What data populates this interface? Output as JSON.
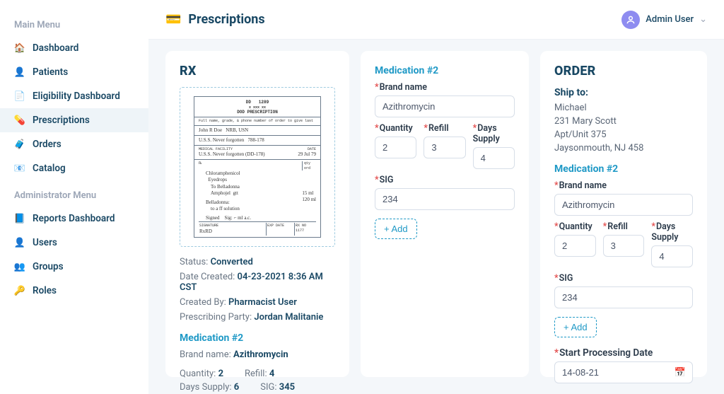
{
  "sidebar": {
    "mainHeader": "Main Menu",
    "adminHeader": "Administrator Menu",
    "main": [
      {
        "icon": "home-icon",
        "glyph": "🏠",
        "label": "Dashboard"
      },
      {
        "icon": "patients-icon",
        "glyph": "👤",
        "label": "Patients"
      },
      {
        "icon": "eligibility-icon",
        "glyph": "📄",
        "label": "Eligibility Dashboard"
      },
      {
        "icon": "prescriptions-icon",
        "glyph": "💊",
        "label": "Prescriptions",
        "active": true
      },
      {
        "icon": "orders-icon",
        "glyph": "🧳",
        "label": "Orders"
      },
      {
        "icon": "catalog-icon",
        "glyph": "📧",
        "label": "Catalog"
      }
    ],
    "admin": [
      {
        "icon": "reports-icon",
        "glyph": "📘",
        "label": "Reports Dashboard"
      },
      {
        "icon": "users-icon",
        "glyph": "👤",
        "label": "Users"
      },
      {
        "icon": "groups-icon",
        "glyph": "👥",
        "label": "Groups"
      },
      {
        "icon": "roles-icon",
        "glyph": "🔑",
        "label": "Roles"
      }
    ]
  },
  "topbar": {
    "title": "Prescriptions",
    "user": "Admin User"
  },
  "rx": {
    "heading": "RX",
    "statusLabel": "Status:",
    "status": "Converted",
    "dateLabel": "Date Created:",
    "date": "04-23-2021 8:36 AM CST",
    "createdByLabel": "Created By:",
    "createdBy": "Pharmacist User",
    "prescribingLabel": "Prescribing Party:",
    "prescribing": "Jordan Malitanie",
    "medTitle": "Medication #2",
    "brandLabel": "Brand name:",
    "brand": "Azithromycin",
    "qtyLabel": "Quantity:",
    "qty": "2",
    "refillLabel": "Refill:",
    "refill": "4",
    "daysLabel": "Days Supply:",
    "days": "6",
    "sigLabel": "SIG:",
    "sig": "345"
  },
  "medForm": {
    "title": "Medication #2",
    "brandLabel": "Brand name",
    "brand": "Azithromycin",
    "qtyLabel": "Quantity",
    "qty": "2",
    "refillLabel": "Refill",
    "refill": "3",
    "daysLabel": "Days Supply",
    "days": "4",
    "sigLabel": "SIG",
    "sig": "234",
    "addLabel": "+ Add"
  },
  "order": {
    "heading": "ORDER",
    "shipLabel": "Ship to:",
    "ship": {
      "name": "Michael",
      "line1": "231 Mary Scott",
      "line2": "Apt/Unit 375",
      "line3": "Jaysonmouth, NJ 458"
    },
    "medTitle": "Medication #2",
    "brandLabel": "Brand name",
    "brand": "Azithromycin",
    "qtyLabel": "Quantity",
    "qty": "2",
    "refillLabel": "Refill",
    "refill": "3",
    "daysLabel": "Days Supply",
    "days": "4",
    "sigLabel": "SIG",
    "sig": "234",
    "addLabel": "+ Add",
    "startLabel": "Start Processing Date",
    "startDate": "14-08-21"
  }
}
